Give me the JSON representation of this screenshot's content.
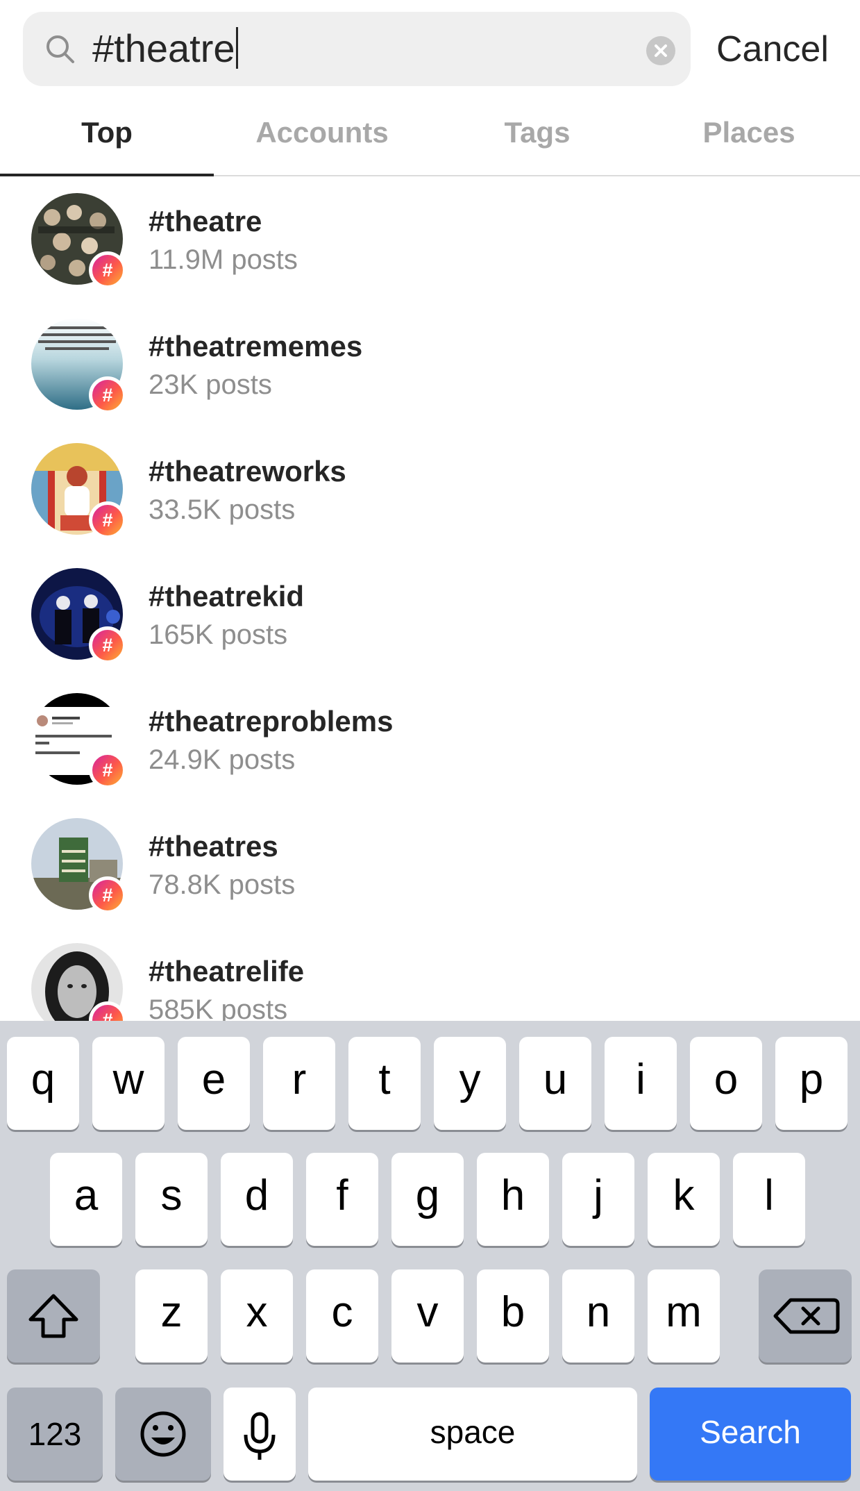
{
  "search": {
    "query": "#theatre",
    "cancel_label": "Cancel"
  },
  "tabs": [
    {
      "label": "Top",
      "active": true
    },
    {
      "label": "Accounts",
      "active": false
    },
    {
      "label": "Tags",
      "active": false
    },
    {
      "label": "Places",
      "active": false
    }
  ],
  "results": [
    {
      "tag": "#theatre",
      "count": "11.9M posts"
    },
    {
      "tag": "#theatrememes",
      "count": "23K posts"
    },
    {
      "tag": "#theatreworks",
      "count": "33.5K posts"
    },
    {
      "tag": "#theatrekid",
      "count": "165K posts"
    },
    {
      "tag": "#theatreproblems",
      "count": "24.9K posts"
    },
    {
      "tag": "#theatres",
      "count": "78.8K posts"
    },
    {
      "tag": "#theatrelife",
      "count": "585K posts"
    }
  ],
  "badge_glyph": "#",
  "keyboard": {
    "row1": [
      "q",
      "w",
      "e",
      "r",
      "t",
      "y",
      "u",
      "i",
      "o",
      "p"
    ],
    "row2": [
      "a",
      "s",
      "d",
      "f",
      "g",
      "h",
      "j",
      "k",
      "l"
    ],
    "row3": [
      "z",
      "x",
      "c",
      "v",
      "b",
      "n",
      "m"
    ],
    "numbers_label": "123",
    "space_label": "space",
    "search_label": "Search",
    "icons": {
      "shift": "shift-arrow-icon",
      "delete": "backspace-icon",
      "emoji": "emoji-face-icon",
      "mic": "microphone-icon"
    }
  },
  "colors": {
    "search_key": "#3478f6",
    "keyboard_bg": "#d1d4da",
    "badge_gradient": [
      "#d6249f",
      "#fd5949",
      "#fdb033"
    ],
    "muted_text": "#8e8e8e"
  }
}
